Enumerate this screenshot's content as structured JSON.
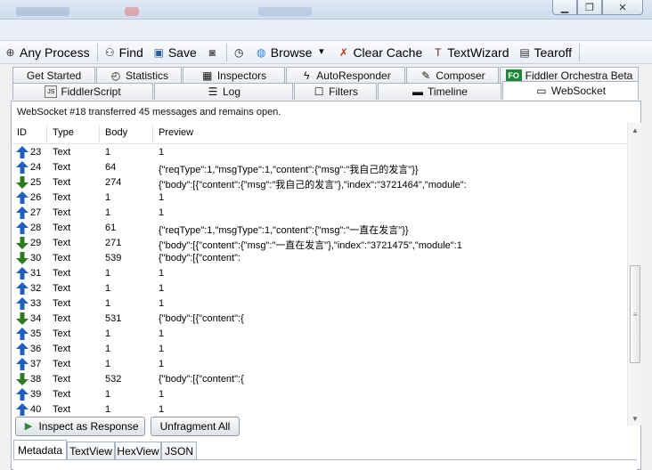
{
  "toolbar": {
    "items": [
      {
        "label": "Any Process",
        "icon": "crosshair-icon",
        "glyph": "⊕",
        "color": "#333333"
      },
      {
        "label": "Find",
        "icon": "binoculars-icon",
        "glyph": "⚇",
        "color": "#222222"
      },
      {
        "label": "Save",
        "icon": "save-icon",
        "glyph": "▣",
        "color": "#2a5da8"
      },
      {
        "label": "",
        "icon": "camera-icon",
        "glyph": "◙",
        "color": "#555555"
      },
      {
        "label": "",
        "icon": "timer-icon",
        "glyph": "◷",
        "color": "#222222"
      },
      {
        "label": "Browse",
        "icon": "globe-icon",
        "glyph": "◍",
        "color": "#2b7fd4",
        "dropdown": "▾"
      },
      {
        "label": "Clear Cache",
        "icon": "eraser-icon",
        "glyph": "✗",
        "color": "#c0392b"
      },
      {
        "label": "TextWizard",
        "icon": "textwizard-icon",
        "glyph": "T",
        "color": "#5b1a1a"
      },
      {
        "label": "Tearoff",
        "icon": "tearoff-icon",
        "glyph": "▤",
        "color": "#333333"
      }
    ]
  },
  "tabs": {
    "row1": [
      {
        "label": "Get Started",
        "icon": "",
        "glyph": ""
      },
      {
        "label": "Statistics",
        "icon": "stopwatch-icon",
        "glyph": "◴"
      },
      {
        "label": "Inspectors",
        "icon": "inspector-icon",
        "glyph": "▦"
      },
      {
        "label": "AutoResponder",
        "icon": "lightning-icon",
        "glyph": "ϟ"
      },
      {
        "label": "Composer",
        "icon": "composer-icon",
        "glyph": "✎"
      },
      {
        "label": "Fiddler Orchestra Beta",
        "icon": "fo-icon",
        "glyph": "FO"
      }
    ],
    "row2": [
      {
        "label": "FiddlerScript",
        "icon": "script-icon",
        "glyph": "JS"
      },
      {
        "label": "Log",
        "icon": "log-icon",
        "glyph": "☰"
      },
      {
        "label": "Filters",
        "icon": "checkbox-icon",
        "glyph": "☐"
      },
      {
        "label": "Timeline",
        "icon": "timeline-icon",
        "glyph": "▬"
      },
      {
        "label": "WebSocket",
        "icon": "websocket-icon",
        "glyph": "▭"
      }
    ]
  },
  "websocket": {
    "status": "WebSocket #18 transferred 45 messages and remains open.",
    "columns": {
      "id": "ID",
      "type": "Type",
      "body": "Body",
      "preview": "Preview"
    },
    "colors": {
      "up": "#1f5fbf",
      "down": "#2f7a1f"
    },
    "rows": [
      {
        "dir": "up",
        "id": "23",
        "type": "Text",
        "body": "1",
        "preview": "1"
      },
      {
        "dir": "up",
        "id": "24",
        "type": "Text",
        "body": "64",
        "preview": "{\"reqType\":1,\"msgType\":1,\"content\":{\"msg\":\"我自己的发言\"}}"
      },
      {
        "dir": "down",
        "id": "25",
        "type": "Text",
        "body": "274",
        "preview": "{\"body\":[{\"content\":{\"msg\":\"我自己的发言\"},\"index\":\"3721464\",\"module\":"
      },
      {
        "dir": "up",
        "id": "26",
        "type": "Text",
        "body": "1",
        "preview": "1"
      },
      {
        "dir": "up",
        "id": "27",
        "type": "Text",
        "body": "1",
        "preview": "1"
      },
      {
        "dir": "up",
        "id": "28",
        "type": "Text",
        "body": "61",
        "preview": "{\"reqType\":1,\"msgType\":1,\"content\":{\"msg\":\"一直在发言\"}}"
      },
      {
        "dir": "down",
        "id": "29",
        "type": "Text",
        "body": "271",
        "preview": "{\"body\":[{\"content\":{\"msg\":\"一直在发言\"},\"index\":\"3721475\",\"module\":1"
      },
      {
        "dir": "down",
        "id": "30",
        "type": "Text",
        "body": "539",
        "preview": "{\"body\":[{\"content\":"
      },
      {
        "dir": "up",
        "id": "31",
        "type": "Text",
        "body": "1",
        "preview": "1"
      },
      {
        "dir": "up",
        "id": "32",
        "type": "Text",
        "body": "1",
        "preview": "1"
      },
      {
        "dir": "up",
        "id": "33",
        "type": "Text",
        "body": "1",
        "preview": "1"
      },
      {
        "dir": "down",
        "id": "34",
        "type": "Text",
        "body": "531",
        "preview": "{\"body\":[{\"content\":{"
      },
      {
        "dir": "up",
        "id": "35",
        "type": "Text",
        "body": "1",
        "preview": "1"
      },
      {
        "dir": "up",
        "id": "36",
        "type": "Text",
        "body": "1",
        "preview": "1"
      },
      {
        "dir": "up",
        "id": "37",
        "type": "Text",
        "body": "1",
        "preview": "1"
      },
      {
        "dir": "down",
        "id": "38",
        "type": "Text",
        "body": "532",
        "preview": "{\"body\":[{\"content\":{"
      },
      {
        "dir": "up",
        "id": "39",
        "type": "Text",
        "body": "1",
        "preview": "1"
      },
      {
        "dir": "up",
        "id": "40",
        "type": "Text",
        "body": "1",
        "preview": "1"
      }
    ],
    "buttons": {
      "inspect": "Inspect as Response",
      "unfragment": "Unfragment All"
    },
    "subtabs": [
      "Metadata",
      "TextView",
      "HexView",
      "JSON"
    ]
  }
}
